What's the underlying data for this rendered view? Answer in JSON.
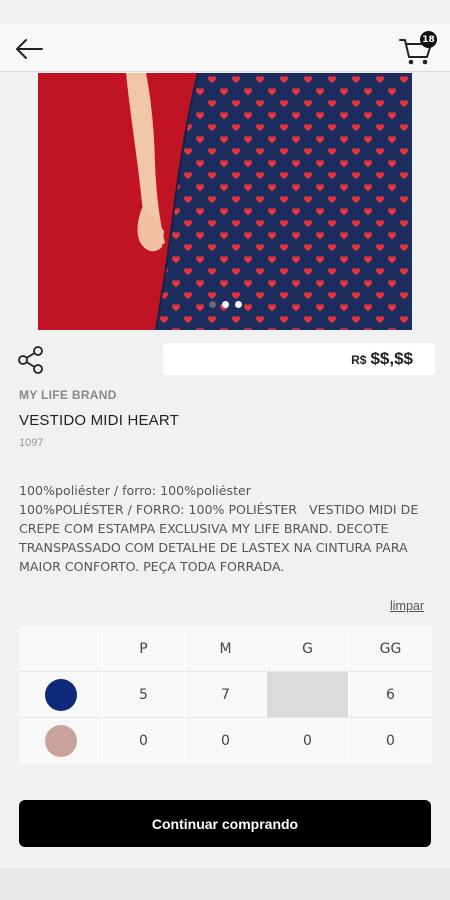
{
  "header": {
    "back_icon": "arrow-left-icon",
    "cart_icon": "shopping-cart-icon",
    "cart_count": "18"
  },
  "gallery": {
    "dots": 3,
    "active_dot": 2
  },
  "product": {
    "share_icon": "share-icon",
    "price_currency": "R$",
    "price_value": "$$,$$",
    "brand": "MY LIFE BRAND",
    "name": "VESTIDO MIDI HEART",
    "sku": "1097",
    "description": "100%poliéster / forro: 100%poliéster\n100%POLIÉSTER / FORRO: 100% POLIÉSTER   VESTIDO MIDI DE CREPE COM ESTAMPA EXCLUSIVA MY LIFE BRAND. DECOTE TRANSPASSADO COM DETALHE DE LASTEX NA CINTURA PARA MAIOR CONFORTO. PEÇA TODA FORRADA."
  },
  "size_grid": {
    "clear_label": "limpar",
    "sizes": [
      "P",
      "M",
      "G",
      "GG"
    ],
    "rows": [
      {
        "color": "#0e2a78",
        "qty": [
          "5",
          "7",
          "",
          "6"
        ]
      },
      {
        "color": "#c9a29b",
        "qty": [
          "0",
          "0",
          "0",
          "0"
        ]
      }
    ]
  },
  "actions": {
    "continue_label": "Continuar comprando"
  },
  "colors": {
    "accent": "#000000",
    "dress_navy": "#1c2d5e",
    "background_red": "#c01424"
  }
}
